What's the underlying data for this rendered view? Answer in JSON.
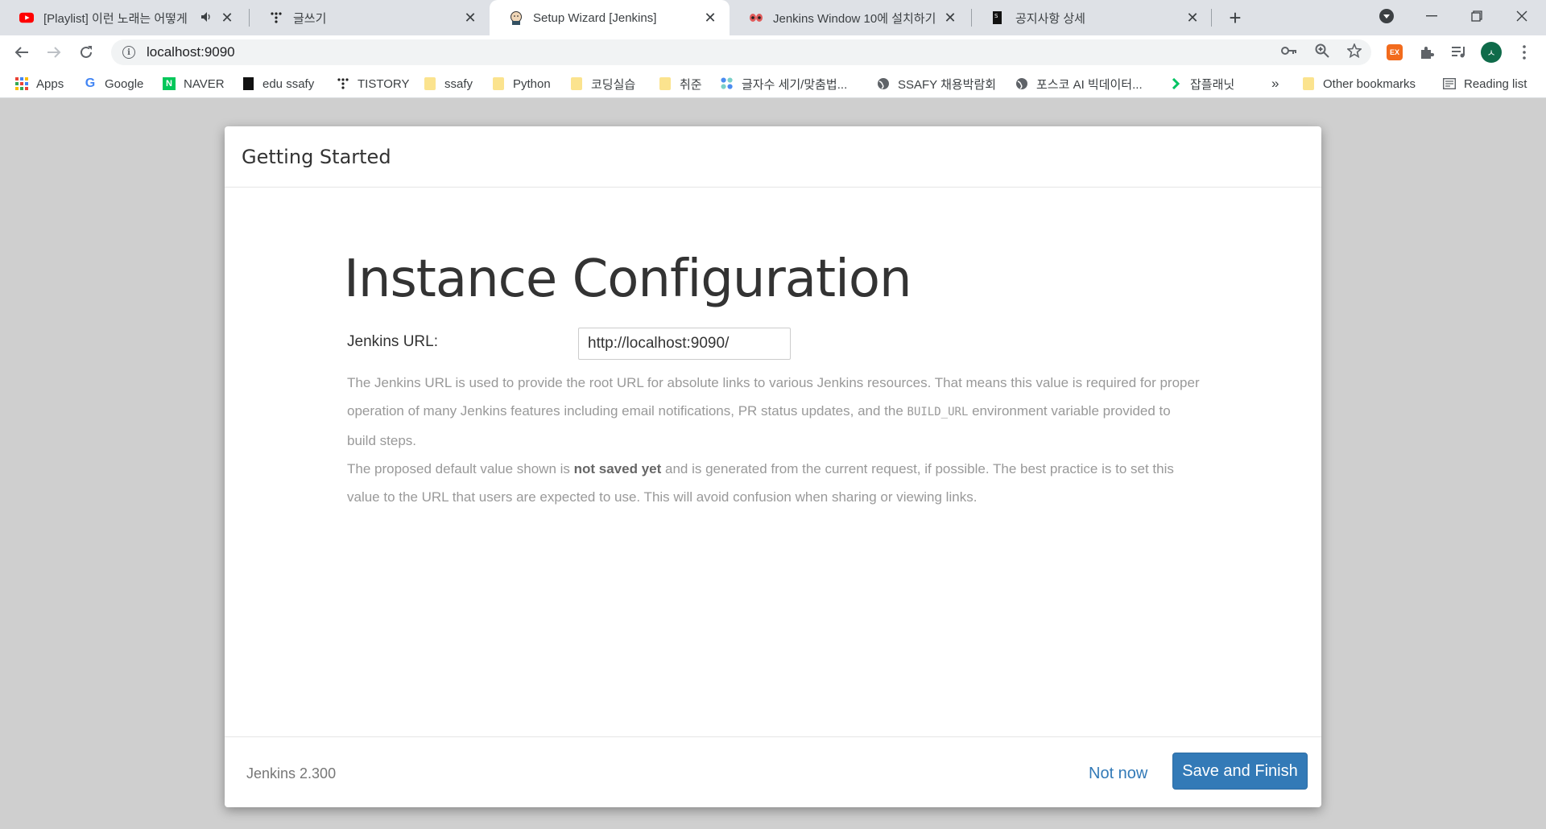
{
  "browser": {
    "tabs": [
      {
        "title": "[Playlist] 이런 노래는 어떻게",
        "icon": "youtube-icon",
        "muted_icon": "speaker-icon"
      },
      {
        "title": "글쓰기",
        "icon": "tistory-icon"
      },
      {
        "title": "Setup Wizard [Jenkins]",
        "icon": "jenkins-icon",
        "active": true
      },
      {
        "title": "Jenkins Window 10에 설치하기",
        "icon": "velog-icon"
      },
      {
        "title": "공지사항 상세",
        "icon": "ssafy-icon"
      }
    ],
    "url": "localhost:9090",
    "bookmarks": [
      {
        "label": "Apps",
        "icon": "apps-grid-icon"
      },
      {
        "label": "Google",
        "icon": "google-icon"
      },
      {
        "label": "NAVER",
        "icon": "naver-icon"
      },
      {
        "label": "edu ssafy",
        "icon": "ssafy-icon"
      },
      {
        "label": "TISTORY",
        "icon": "tistory-icon"
      },
      {
        "label": "ssafy",
        "icon": "folder-icon"
      },
      {
        "label": "Python",
        "icon": "folder-icon"
      },
      {
        "label": "코딩실습",
        "icon": "folder-icon"
      },
      {
        "label": "취준",
        "icon": "folder-icon"
      },
      {
        "label": "글자수 세기/맞춤법...",
        "icon": "dots-icon"
      },
      {
        "label": "SSAFY 채용박람회",
        "icon": "globe-icon"
      },
      {
        "label": "포스코 AI 빅데이터...",
        "icon": "globe-icon"
      },
      {
        "label": "잡플래닛",
        "icon": "jobplanet-icon"
      }
    ],
    "overflow": "»",
    "other_bookmarks": "Other bookmarks",
    "reading_list": "Reading list",
    "profile_initial": "ㅅ",
    "extension_badge": "EX"
  },
  "dialog": {
    "header": "Getting Started",
    "heading": "Instance Configuration",
    "url_label": "Jenkins URL:",
    "url_value": "http://localhost:9090/",
    "help_p1_a": "The Jenkins URL is used to provide the root URL for absolute links to various Jenkins resources. That means this value is required for proper operation of many Jenkins features including email notifications, PR status updates, and the ",
    "help_p1_code": "BUILD_URL",
    "help_p1_b": " environment variable provided to build steps.",
    "help_p2_a": "The proposed default value shown is ",
    "help_p2_bold": "not saved yet",
    "help_p2_b": " and is generated from the current request, if possible. The best practice is to set this value to the URL that users are expected to use. This will avoid confusion when sharing or viewing links.",
    "version": "Jenkins 2.300",
    "not_now": "Not now",
    "save_finish": "Save and Finish"
  },
  "colors": {
    "primary_button": "#337ab7",
    "link": "#337ab7",
    "overlay": "#cfcfcf"
  }
}
